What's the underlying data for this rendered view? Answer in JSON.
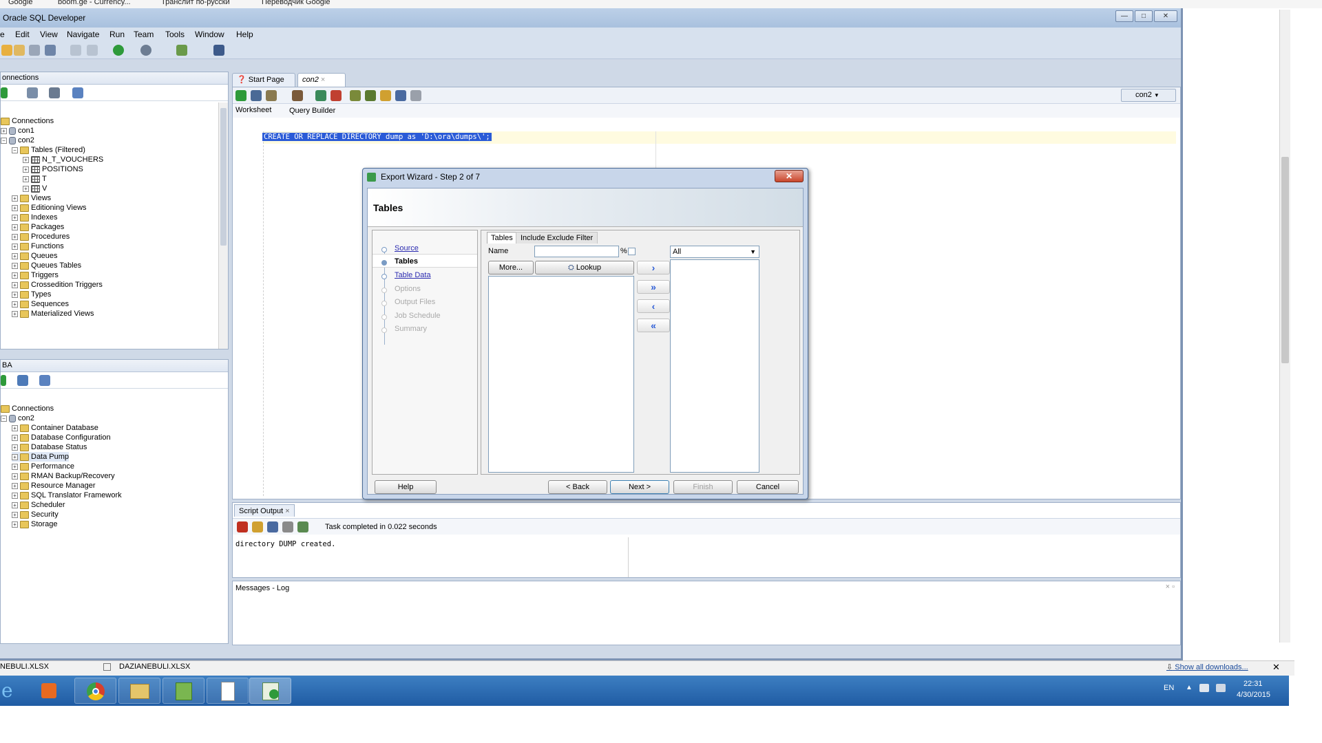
{
  "bookmarks": [
    "Google",
    "boom.ge - Currency...",
    "Транслит по-русски",
    "Переводчик Google"
  ],
  "window": {
    "title": "Oracle SQL Developer"
  },
  "menu": [
    "e",
    "Edit",
    "View",
    "Navigate",
    "Run",
    "Team",
    "Tools",
    "Window",
    "Help"
  ],
  "connections_panel": {
    "title": "onnections",
    "root": "Connections",
    "items": [
      {
        "label": "con1",
        "icon": "db-icon",
        "level": 1
      },
      {
        "label": "con2",
        "icon": "db-icon",
        "level": 1
      },
      {
        "label": "Tables (Filtered)",
        "icon": "folder-icon",
        "level": 2
      },
      {
        "label": "N_T_VOUCHERS",
        "icon": "table-icon",
        "level": 3
      },
      {
        "label": "POSITIONS",
        "icon": "table-icon",
        "level": 3
      },
      {
        "label": "T",
        "icon": "table-icon",
        "level": 3
      },
      {
        "label": "V",
        "icon": "table-icon",
        "level": 3
      },
      {
        "label": "Views",
        "icon": "folder-icon",
        "level": 2
      },
      {
        "label": "Editioning Views",
        "icon": "folder-icon",
        "level": 2
      },
      {
        "label": "Indexes",
        "icon": "folder-icon",
        "level": 2
      },
      {
        "label": "Packages",
        "icon": "folder-icon",
        "level": 2
      },
      {
        "label": "Procedures",
        "icon": "folder-icon",
        "level": 2
      },
      {
        "label": "Functions",
        "icon": "folder-icon",
        "level": 2
      },
      {
        "label": "Queues",
        "icon": "folder-icon",
        "level": 2
      },
      {
        "label": "Queues Tables",
        "icon": "folder-icon",
        "level": 2
      },
      {
        "label": "Triggers",
        "icon": "folder-icon",
        "level": 2
      },
      {
        "label": "Crossedition Triggers",
        "icon": "folder-icon",
        "level": 2
      },
      {
        "label": "Types",
        "icon": "folder-icon",
        "level": 2
      },
      {
        "label": "Sequences",
        "icon": "folder-icon",
        "level": 2
      },
      {
        "label": "Materialized Views",
        "icon": "folder-icon",
        "level": 2
      }
    ]
  },
  "dba_panel": {
    "title": "BA",
    "root": "Connections",
    "items": [
      {
        "label": "con2",
        "icon": "db-icon",
        "level": 1
      },
      {
        "label": "Container Database",
        "icon": "folder-icon",
        "level": 2
      },
      {
        "label": "Database Configuration",
        "icon": "folder-icon",
        "level": 2
      },
      {
        "label": "Database Status",
        "icon": "folder-icon",
        "level": 2
      },
      {
        "label": "Data Pump",
        "icon": "folder-icon",
        "level": 2,
        "selected": true
      },
      {
        "label": "Performance",
        "icon": "folder-icon",
        "level": 2
      },
      {
        "label": "RMAN Backup/Recovery",
        "icon": "folder-icon",
        "level": 2
      },
      {
        "label": "Resource Manager",
        "icon": "folder-icon",
        "level": 2
      },
      {
        "label": "SQL Translator Framework",
        "icon": "folder-icon",
        "level": 2
      },
      {
        "label": "Scheduler",
        "icon": "folder-icon",
        "level": 2
      },
      {
        "label": "Security",
        "icon": "folder-icon",
        "level": 2
      },
      {
        "label": "Storage",
        "icon": "folder-icon",
        "level": 2
      }
    ]
  },
  "editor": {
    "tabs": [
      "Start Page",
      "con2"
    ],
    "connection": "con2",
    "subtabs": [
      "Worksheet",
      "Query Builder"
    ],
    "sql": "CREATE OR REPLACE DIRECTORY dump as 'D:\\ora\\dumps\\';"
  },
  "script_output": {
    "tab": "Script Output",
    "status": "Task completed in 0.022 seconds",
    "text": "directory DUMP created."
  },
  "messages": {
    "title": "Messages - Log"
  },
  "dialog": {
    "title": "Export Wizard - Step 2 of 7",
    "header": "Tables",
    "steps": [
      {
        "label": "Source",
        "state": "link"
      },
      {
        "label": "Tables",
        "state": "current"
      },
      {
        "label": "Table Data",
        "state": "link"
      },
      {
        "label": "Options",
        "state": "disabled"
      },
      {
        "label": "Output Files",
        "state": "disabled"
      },
      {
        "label": "Job Schedule",
        "state": "disabled"
      },
      {
        "label": "Summary",
        "state": "disabled"
      }
    ],
    "tabs": [
      "Tables",
      "Include Exclude Filter"
    ],
    "name_label": "Name",
    "name_value": "",
    "percent": "%",
    "more_label": "More...",
    "lookup_label": "Lookup",
    "filter_select": "All",
    "buttons": {
      "help": "Help",
      "back": "< Back",
      "next": "Next >",
      "finish": "Finish",
      "cancel": "Cancel"
    }
  },
  "downloads": {
    "items": [
      "NEBULI.XLSX",
      "DAZIANEBULI.XLSX"
    ],
    "show_all": "Show all downloads..."
  },
  "taskbar": {
    "lang": "EN",
    "time": "22:31",
    "date": "4/30/2015"
  }
}
